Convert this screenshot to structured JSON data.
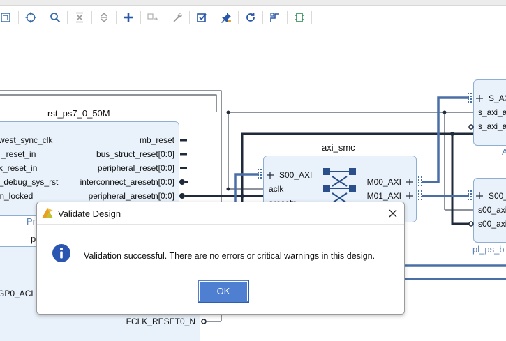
{
  "toolbar": {
    "icons": [
      "regenerate-layout-icon",
      "zoom-fit-icon",
      "search-icon",
      "collapse-all-icon",
      "expand-all-icon",
      "add-ip-icon",
      "create-port-icon",
      "wrench-icon",
      "validate-design-icon",
      "pin-icon",
      "refresh-icon",
      "route-icon",
      "chip-icon"
    ]
  },
  "canvas": {
    "rst_block": {
      "title": "rst_ps7_0_50M",
      "sub": "Pr",
      "left_ports": [
        "west_sync_clk",
        "_reset_in",
        "x_reset_in",
        "p_debug_sys_rst",
        "m_locked"
      ],
      "right_ports": [
        "mb_reset",
        "bus_struct_reset[0:0]",
        "peripheral_reset[0:0]",
        "interconnect_aresetn[0:0]",
        "peripheral_aresetn[0:0]"
      ]
    },
    "axi_smc": {
      "title": "axi_smc",
      "left_ports": [
        "S00_AXI",
        "aclk",
        "aresetn"
      ],
      "right_ports": [
        "M00_AXI",
        "M01_AXI"
      ]
    },
    "right_top_block": {
      "ports": [
        "S_AXI",
        "s_axi_a",
        "s_axi_a"
      ],
      "sub": "A"
    },
    "right_bottom_block": {
      "ports": [
        "S00_",
        "s00_axi",
        "s00_axi"
      ],
      "sub": "pl_ps_b"
    },
    "ps_block": {
      "sub": "p",
      "left_port": "GP0_ACL",
      "bottom_port": "FCLK_RESET0_N"
    }
  },
  "dialog": {
    "title": "Validate Design",
    "message": "Validation successful. There are no errors or critical warnings in this design.",
    "ok_label": "OK"
  },
  "colors": {
    "block_fill": "#e9f2fb",
    "block_border": "#8eafd2",
    "bus_wire": "#4a6fa5",
    "net_wire": "#1f2a3a",
    "ok_button": "#4f7fd0",
    "info_icon": "#2a55b0"
  }
}
